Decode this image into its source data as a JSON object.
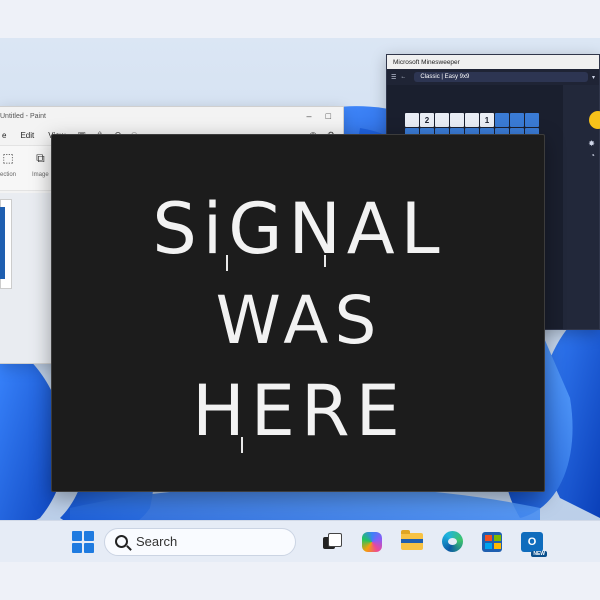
{
  "colors": {
    "accent": "#1f7be0",
    "poster_bg": "#1c1c1c",
    "poster_text": "#f2f2f2"
  },
  "paint": {
    "title": "Untitled - Paint",
    "menus": [
      "e",
      "Edit",
      "View"
    ],
    "tool_labels": {
      "selection": "ection",
      "image": "Image"
    },
    "window_controls": [
      "–",
      "□"
    ]
  },
  "minesweeper": {
    "title": "Microsoft Minesweeper",
    "mode": "Classic | Easy 9x9",
    "board_top_row": [
      "",
      "2",
      "",
      "",
      "",
      "1",
      "",
      "",
      ""
    ],
    "toolbar_labels": {
      "menu": "Menu",
      "back": "Back"
    }
  },
  "poster": {
    "lines": [
      "SiGNAL",
      "WAS",
      "HERE"
    ]
  },
  "taskbar": {
    "search_placeholder": "Search",
    "outlook_badge": "NEW",
    "outlook_letter": "O"
  }
}
